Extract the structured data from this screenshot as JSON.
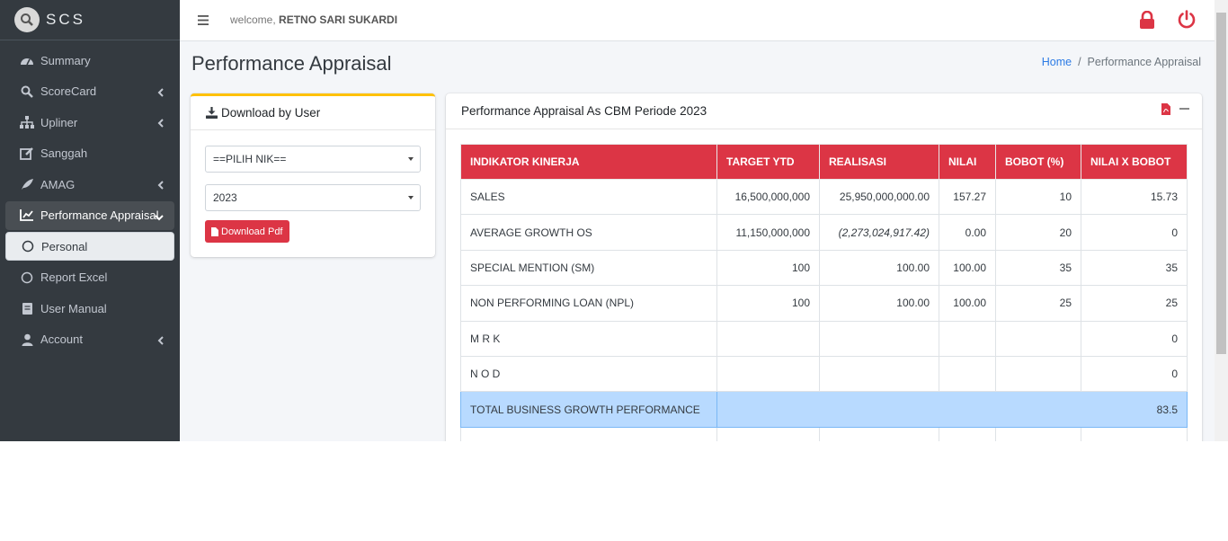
{
  "brand": {
    "name": "SCS"
  },
  "sidebar": {
    "items": [
      {
        "label": "Summary",
        "icon": "dashboard-icon"
      },
      {
        "label": "ScoreCard",
        "icon": "search-icon"
      },
      {
        "label": "Upliner",
        "icon": "sitemap-icon"
      },
      {
        "label": "Sanggah",
        "icon": "edit-icon"
      },
      {
        "label": "AMAG",
        "icon": "feather-icon"
      },
      {
        "label": "Performance Appraisal",
        "icon": "chart-line-icon"
      },
      {
        "label": "Personal",
        "icon": "circle-icon"
      },
      {
        "label": "Report Excel",
        "icon": "circle-icon"
      },
      {
        "label": "User Manual",
        "icon": "book-icon"
      },
      {
        "label": "Account",
        "icon": "user-icon"
      }
    ]
  },
  "header": {
    "welcome_prefix": "welcome,",
    "user_name": "RETNO SARI SUKARDI"
  },
  "page": {
    "title": "Performance Appraisal",
    "breadcrumb_home": "Home",
    "breadcrumb_sep": "/",
    "breadcrumb_current": "Performance Appraisal"
  },
  "download": {
    "title": "Download by User",
    "nik_select": "==PILIH NIK==",
    "year_select": "2023",
    "button": "Download Pdf"
  },
  "appraisal": {
    "title": "Performance Appraisal As CBM Periode 2023",
    "columns": [
      "INDIKATOR KINERJA",
      "TARGET YTD",
      "REALISASI",
      "NILAI",
      "BOBOT (%)",
      "NILAI X BOBOT"
    ],
    "rows": [
      {
        "indikator": "SALES",
        "target": "16,500,000,000",
        "realisasi": "25,950,000,000.00",
        "nilai": "157.27",
        "bobot": "10",
        "nilai_bobot": "15.73"
      },
      {
        "indikator": "AVERAGE GROWTH OS",
        "target": "11,150,000,000",
        "realisasi": "(2,273,024,917.42)",
        "nilai": "0.00",
        "bobot": "20",
        "nilai_bobot": "0"
      },
      {
        "indikator": "SPECIAL MENTION (SM)",
        "target": "100",
        "realisasi": "100.00",
        "nilai": "100.00",
        "bobot": "35",
        "nilai_bobot": "35"
      },
      {
        "indikator": "NON PERFORMING LOAN (NPL)",
        "target": "100",
        "realisasi": "100.00",
        "nilai": "100.00",
        "bobot": "25",
        "nilai_bobot": "25"
      },
      {
        "indikator": "M R K",
        "target": "",
        "realisasi": "",
        "nilai": "",
        "bobot": "",
        "nilai_bobot": "0"
      },
      {
        "indikator": "N O D",
        "target": "",
        "realisasi": "",
        "nilai": "",
        "bobot": "",
        "nilai_bobot": "0"
      }
    ],
    "total": {
      "label": "TOTAL BUSINESS GROWTH PERFORMANCE",
      "value": "83.5"
    }
  },
  "colors": {
    "accent_red": "#dc3545",
    "sidebar_bg": "#343a40",
    "total_row": "#b8daff",
    "card_top": "#ffc107"
  }
}
